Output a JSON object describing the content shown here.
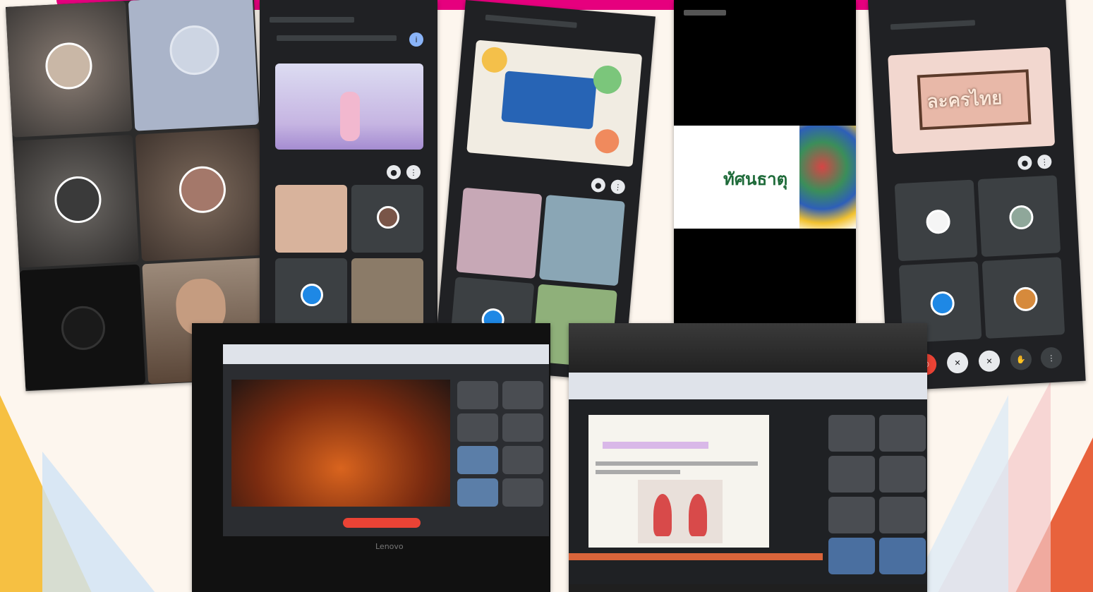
{
  "slide": {
    "accent_color": "#e6007e",
    "background_color": "#fdf6ee"
  },
  "phone_card": {
    "title": "ทัศนธาตุ",
    "icon": "peacock-art-icon"
  },
  "phone_banner": {
    "title": "ละครไทย"
  },
  "laptop": {
    "brand": "Lenovo"
  },
  "colors": {
    "meet_dark": "#202124",
    "tile_gray": "#3c4043",
    "thai_title_green": "#1f6b3a",
    "stage_orange": "#d9641e",
    "hang_up_red": "#ea4335"
  }
}
